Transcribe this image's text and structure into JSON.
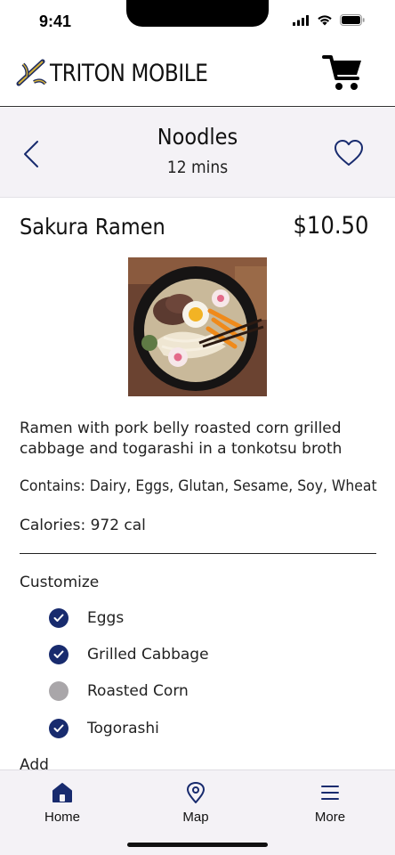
{
  "status_bar": {
    "time": "9:41"
  },
  "header": {
    "brand_name": "TRITON MOBILE"
  },
  "category": {
    "title": "Noodles",
    "wait_time": "12 mins"
  },
  "item": {
    "name": "Sakura Ramen",
    "price": "$10.50",
    "description": "Ramen with pork belly roasted corn grilled cabbage and togarashi in a tonkotsu broth",
    "allergens": "Contains: Dairy, Eggs, Glutan, Sesame, Soy, Wheat",
    "calories": "Calories: 972 cal"
  },
  "customize": {
    "label": "Customize",
    "options": [
      {
        "label": "Eggs",
        "checked": true
      },
      {
        "label": "Grilled Cabbage",
        "checked": true
      },
      {
        "label": "Roasted Corn",
        "checked": false
      },
      {
        "label": "Togorashi",
        "checked": true
      }
    ]
  },
  "add_section": {
    "label": "Add"
  },
  "tabs": [
    {
      "label": "Home",
      "icon": "home-icon"
    },
    {
      "label": "Map",
      "icon": "map-pin-icon"
    },
    {
      "label": "More",
      "icon": "menu-icon"
    }
  ],
  "colors": {
    "accent": "#182b6e",
    "unchecked": "#a9a6a9",
    "surface": "#f4f2f6"
  }
}
